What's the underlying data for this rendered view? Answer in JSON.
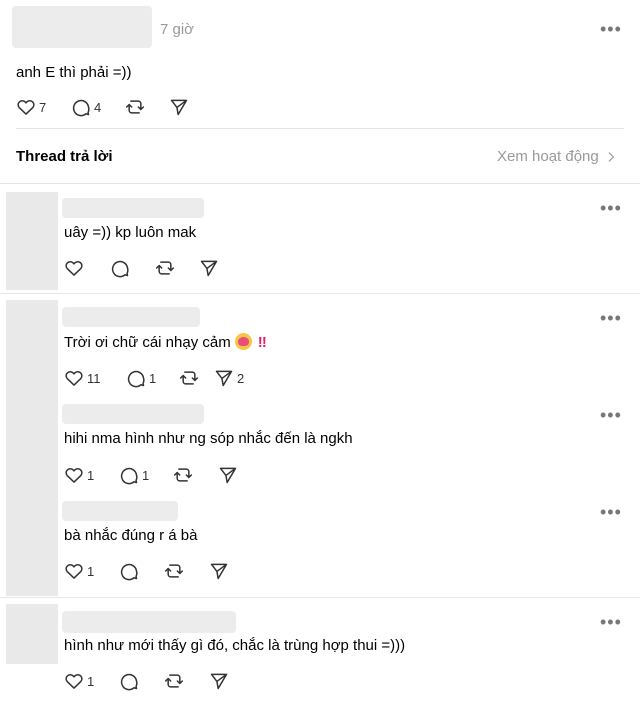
{
  "top_post": {
    "time": "7 giờ",
    "text": "anh E thì phải =))",
    "likes": "7",
    "replies": "4"
  },
  "reply_section": {
    "title": "Thread trả lời",
    "see_activity": "Xem hoạt động"
  },
  "comments": [
    {
      "text": "uây =)) kp luôn mak",
      "likes": "",
      "replies": "",
      "shares": ""
    },
    {
      "text": "Trời ơi chữ cái nhạy cảm",
      "emoji": "face-with-hearts",
      "emphasis": "‼",
      "likes": "11",
      "replies": "1",
      "shares": "2"
    },
    {
      "text": "hihi nma hình như ng sóp nhắc đến là ngkh",
      "likes": "1",
      "replies": "1",
      "shares": ""
    },
    {
      "text": "bà nhắc đúng r á bà",
      "likes": "1",
      "replies": "",
      "shares": ""
    },
    {
      "text": "hình như mới thấy gì đó, chắc là trùng hợp thui =)))",
      "likes": "1",
      "replies": "",
      "shares": ""
    }
  ],
  "icons": {
    "like": "heart-icon",
    "reply": "comment-bubble-icon",
    "repost": "repost-icon",
    "share": "send-icon",
    "more": "more-icon",
    "chevron": "chevron-right-icon"
  }
}
